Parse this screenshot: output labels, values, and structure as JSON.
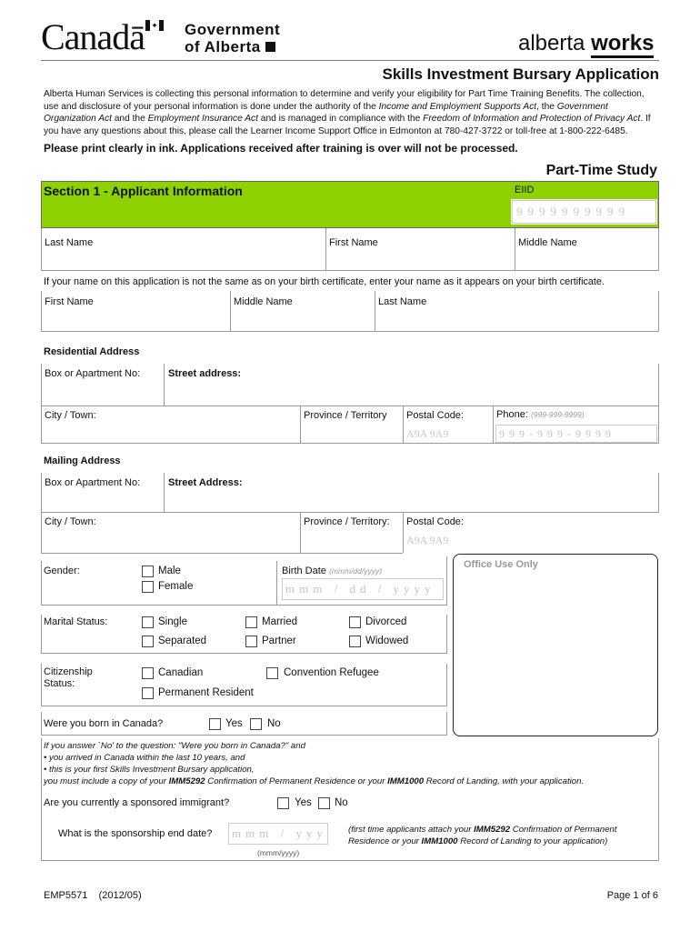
{
  "header": {
    "canada_wordmark": "Canadā",
    "gov_line1": "Government",
    "gov_line2": "of Alberta",
    "brand_light": "alberta",
    "brand_bold": "works",
    "title": "Skills Investment Bursary Application",
    "intro": {
      "p1": "Alberta Human Services is collecting this personal information to determine and verify your eligibility for Part Time Training Benefits. The collection, use and disclosure of your personal information is done under the authority of the ",
      "act1": "Income and Employment Supports Act",
      "p2": ", the ",
      "act2": "Government Organization Act",
      "p3": " and the ",
      "act3": "Employment Insurance Act",
      "p4": " and is managed in compliance with the ",
      "act4": "Freedom of Information and Protection of Privacy Act",
      "p5": ". If you have any questions about this, please call the Learner Income Support Office in Edmonton at 780-427-3722 or toll-free at 1-800-222-6485."
    },
    "print_notice": "Please print clearly in ink.  Applications received after training is over will not be processed.",
    "study_type": "Part-Time Study"
  },
  "section1": {
    "title": "Section 1 - Applicant Information",
    "accent_color": "#8dd200",
    "eiid_label": "EIID",
    "eiid_placeholder": "9999999999",
    "name_fields": [
      "Last Name",
      "First Name",
      "Middle Name"
    ],
    "birth_cert_note": "If your name on this application is not the same as on your birth certificate, enter your name as it appears on your birth certificate.",
    "birth_cert_fields": [
      "First Name",
      "Middle Name",
      "Last Name"
    ],
    "residential": {
      "heading": "Residential Address",
      "box_apt": "Box or Apartment No:",
      "street": "Street address:",
      "city": "City / Town:",
      "province": "Province / Territory",
      "postal": "Postal Code:",
      "postal_placeholder": "A9A 9A9",
      "phone": "Phone:",
      "phone_hint": "(999-999-9999)",
      "phone_placeholder": "999-999-9999"
    },
    "mailing": {
      "heading": "Mailing Address",
      "box_apt": "Box or Apartment No:",
      "street": "Street Address:",
      "city": "City / Town:",
      "province": "Province / Territory:",
      "postal": "Postal Code:",
      "postal_placeholder": "A9A 9A9"
    },
    "gender": {
      "label": "Gender:",
      "options": [
        "Male",
        "Female"
      ]
    },
    "birth_date": {
      "label": "Birth Date",
      "hint": "(mmm/dd/yyyy)",
      "placeholder": "mmm / dd / yyyy"
    },
    "marital": {
      "label": "Marital Status:",
      "options": [
        "Single",
        "Married",
        "Divorced",
        "Separated",
        "Partner",
        "Widowed"
      ]
    },
    "citizenship": {
      "label_line1": "Citizenship",
      "label_line2": "Status:",
      "options": [
        "Canadian",
        "Convention Refugee",
        "Permanent Resident"
      ]
    },
    "born_in_canada": {
      "label": "Were you born in Canada?",
      "options": [
        "Yes",
        "No"
      ]
    },
    "office_use": "Office Use Only",
    "note": {
      "line1": "If you answer `No' to the question: \"Were you born in Canada?\" and",
      "bullet1": "• you arrived in Canada within the last 10 years, and",
      "bullet2": "• this is your first Skills Investment Bursary application,",
      "line4a": "you must include a copy of your ",
      "doc1": "IMM5292",
      "line4b": " Confirmation of Permanent Residence or your ",
      "doc2": "IMM1000",
      "line4c": " Record of Landing, with your application."
    },
    "sponsored": {
      "label": "Are you currently a sponsored  immigrant?",
      "options": [
        "Yes",
        "No"
      ]
    },
    "sponsorship_end": {
      "label": "What is the sponsorship end date?",
      "placeholder": "mmm / yyyy",
      "hint": "(mmm/yyyy)",
      "note_a": "(first time applicants attach your ",
      "doc1": "IMM5292",
      "note_b": " Confirmation of Permanent Residence or your ",
      "doc2": "IMM1000",
      "note_c": " Record of Landing to your application)"
    }
  },
  "footer": {
    "form_code": "EMP5571",
    "form_date": "(2012/05)",
    "page": "Page 1 of 6"
  }
}
